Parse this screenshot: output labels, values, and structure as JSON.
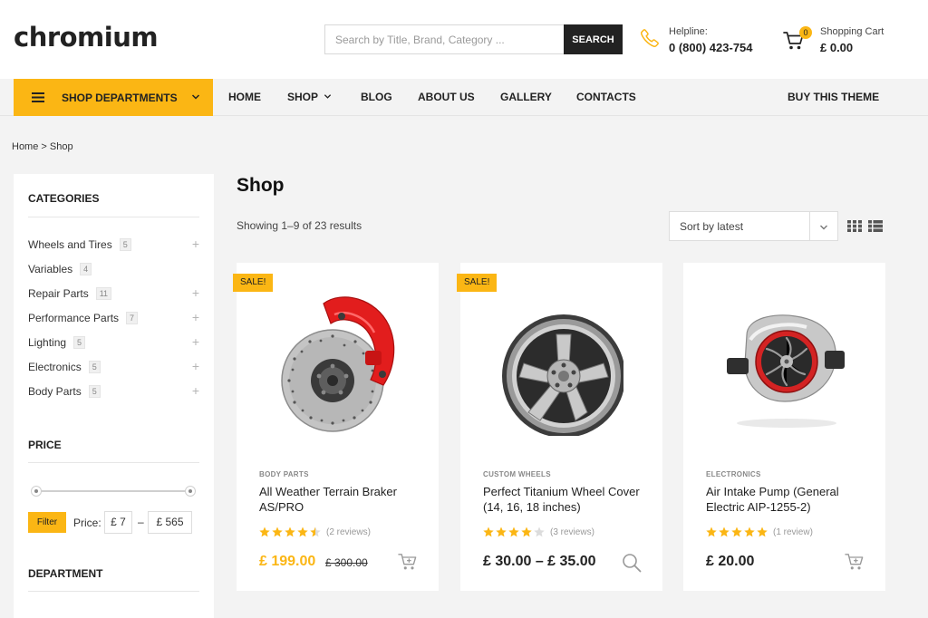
{
  "header": {
    "logo": "chromium",
    "search_placeholder": "Search by Title, Brand, Category ...",
    "search_button": "SEARCH",
    "helpline_label": "Helpline:",
    "helpline_number": "0 (800) 423-754",
    "cart_label": "Shopping Cart",
    "cart_total": "£ 0.00",
    "cart_count": "0"
  },
  "nav": {
    "departments": "SHOP DEPARTMENTS",
    "items": [
      "HOME",
      "SHOP",
      "BLOG",
      "ABOUT US",
      "GALLERY",
      "CONTACTS"
    ],
    "buy": "BUY THIS THEME"
  },
  "breadcrumb": {
    "home": "Home",
    "separator": ">",
    "current": "Shop"
  },
  "sidebar": {
    "categories_title": "CATEGORIES",
    "categories": [
      {
        "name": "Wheels and Tires",
        "count": "5",
        "expandable": true
      },
      {
        "name": "Variables",
        "count": "4",
        "expandable": false
      },
      {
        "name": "Repair Parts",
        "count": "11",
        "expandable": true
      },
      {
        "name": "Performance Parts",
        "count": "7",
        "expandable": true
      },
      {
        "name": "Lighting",
        "count": "5",
        "expandable": true
      },
      {
        "name": "Electronics",
        "count": "5",
        "expandable": true
      },
      {
        "name": "Body Parts",
        "count": "5",
        "expandable": true
      }
    ],
    "price_title": "PRICE",
    "filter_button": "Filter",
    "price_label": "Price:",
    "price_min": "£ 7",
    "price_dash": "–",
    "price_max": "£ 565",
    "department_title": "DEPARTMENT"
  },
  "main": {
    "title": "Shop",
    "results": "Showing 1–9 of 23 results",
    "sort": "Sort by latest"
  },
  "products": [
    {
      "category": "BODY PARTS",
      "name": "All Weather Terrain Braker AS/PRO",
      "rating": 4.5,
      "reviews": "(2 reviews)",
      "price": "£ 199.00",
      "old_price": "£ 300.00",
      "sale": "SALE!",
      "action": "cart-icon"
    },
    {
      "category": "CUSTOM WHEELS",
      "name": "Perfect Titanium Wheel Cover (14, 16, 18 inches)",
      "rating": 4,
      "reviews": "(3 reviews)",
      "price": "£ 30.00 – £ 35.00",
      "sale": "SALE!",
      "action": "search-icon"
    },
    {
      "category": "ELECTRONICS",
      "name": "Air Intake Pump (General Electric AIP-1255-2)",
      "rating": 5,
      "reviews": "(1 review)",
      "price": "£ 20.00",
      "action": "cart-icon"
    }
  ],
  "colors": {
    "accent": "#fbb614",
    "dark": "#222222",
    "background": "#f3f3f3"
  }
}
